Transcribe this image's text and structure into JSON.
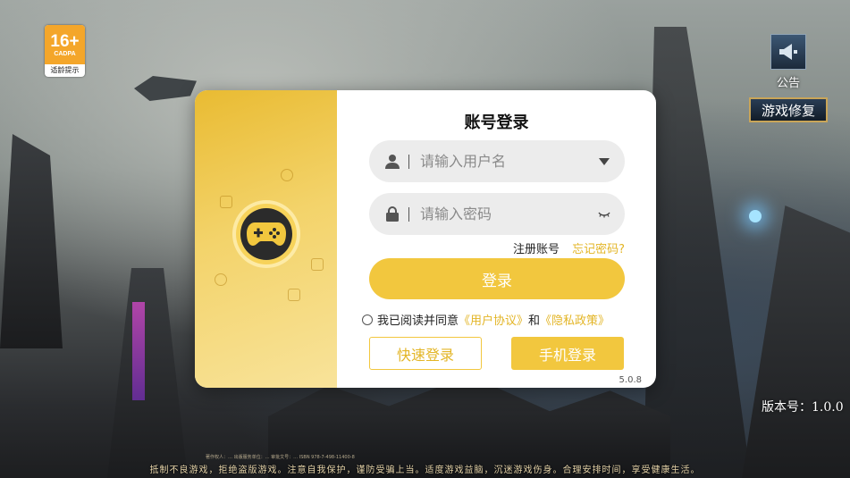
{
  "age_badge": {
    "rating": "16+",
    "org": "CADPA",
    "tip": "适龄提示"
  },
  "notice": {
    "label": "公告",
    "icon": "megaphone-icon"
  },
  "repair": {
    "label": "游戏修复"
  },
  "version_right": "版本号：1.0.0",
  "footer": {
    "line_small": "著作权人：… 出版服务单位：… 审批文号：… ISBN 978-7-498-11400-8",
    "line_main": "抵制不良游戏，拒绝盗版游戏。注意自我保护，谨防受骗上当。适度游戏益脑，沉迷游戏伤身。合理安排时间，享受健康生活。"
  },
  "dialog": {
    "title": "账号登录",
    "username_placeholder": "请输入用户名",
    "password_placeholder": "请输入密码",
    "register_label": "注册账号",
    "forgot_label": "忘记密码?",
    "login_label": "登录",
    "agree_prefix": "我已阅读并同意",
    "user_agreement": "《用户协议》",
    "and": "和",
    "privacy_policy": "《隐私政策》",
    "quick_login": "快速登录",
    "phone_login": "手机登录",
    "version": "5.0.8"
  },
  "colors": {
    "accent": "#f2c73e",
    "link": "#e3b526"
  }
}
